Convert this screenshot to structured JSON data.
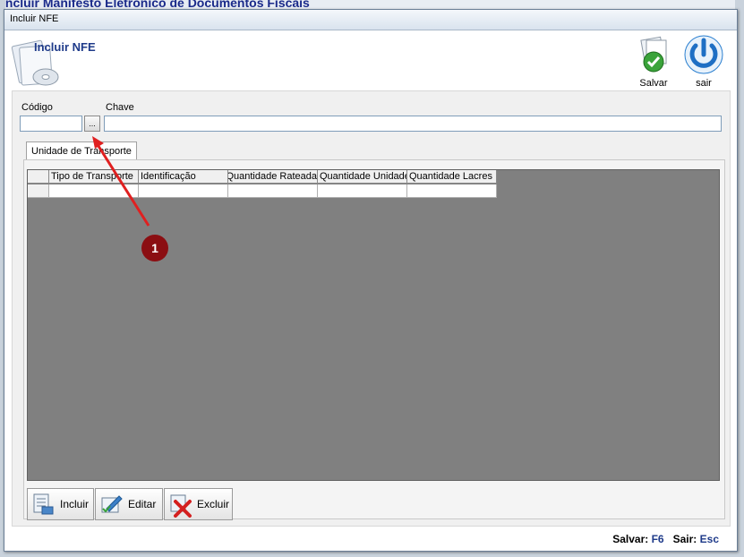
{
  "background": {
    "app_title": "Incluir Manifesto Eletrônico de Documentos Fiscais"
  },
  "window": {
    "title": "Incluir NFE"
  },
  "header": {
    "title": "Incluir NFE",
    "save_label": "Salvar",
    "exit_label": "sair"
  },
  "form": {
    "codigo_label": "Código",
    "codigo_value": "",
    "lookup_label": "...",
    "chave_label": "Chave",
    "chave_value": ""
  },
  "tabs": [
    {
      "label": "Unidade de Transporte",
      "active": true
    }
  ],
  "grid": {
    "columns": [
      "Tipo de Transporte",
      "Identificação",
      "Quantidade Rateada",
      "Quantidade Unidade",
      "Quantidade Lacres"
    ],
    "rows": [
      [
        "",
        "",
        "",
        "",
        ""
      ]
    ]
  },
  "actions": {
    "add_label": "Incluir",
    "edit_label": "Editar",
    "delete_label": "Excluir"
  },
  "statusbar": {
    "save_prefix": "Salvar:",
    "save_key": "F6",
    "exit_prefix": "Sair:",
    "exit_key": "Esc"
  },
  "annotation": {
    "number": "1",
    "color": "#8b0e12",
    "arrow_color": "#e02020"
  },
  "colors": {
    "accent": "#1f3b8a",
    "grid_background": "#808080"
  }
}
